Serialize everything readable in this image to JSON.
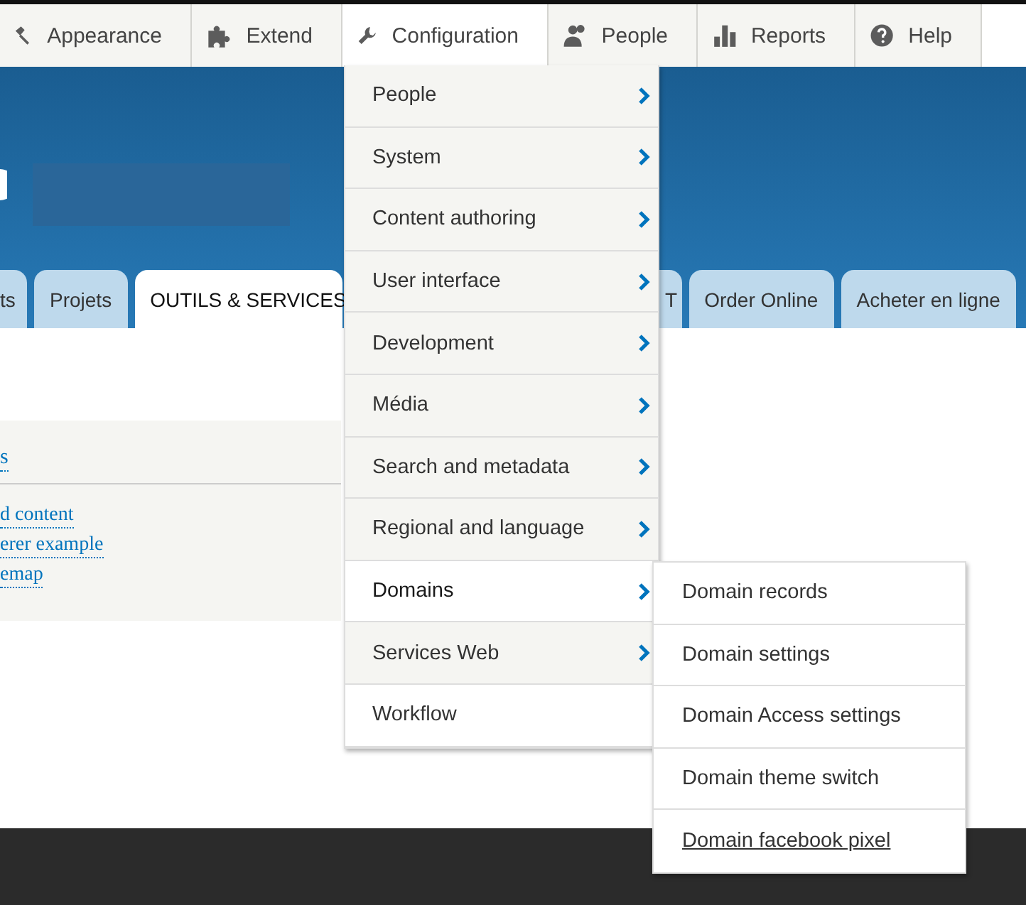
{
  "toolbar": {
    "items": [
      {
        "label": "Appearance",
        "selected": false
      },
      {
        "label": "Extend",
        "selected": false
      },
      {
        "label": "Configuration",
        "selected": true
      },
      {
        "label": "People",
        "selected": false
      },
      {
        "label": "Reports",
        "selected": false
      },
      {
        "label": "Help",
        "selected": false
      }
    ]
  },
  "header": {
    "tabs": [
      {
        "label": "ts",
        "selected": false
      },
      {
        "label": "Projets",
        "selected": false
      },
      {
        "label": "OUTILS & SERVICES",
        "selected": true
      },
      {
        "label": "T",
        "selected": false
      },
      {
        "label": "Order Online",
        "selected": false
      },
      {
        "label": "Acheter en ligne",
        "selected": false
      }
    ]
  },
  "panel": {
    "heading": "s",
    "links": [
      "d content",
      "erer example",
      "emap"
    ]
  },
  "menu": {
    "items": [
      {
        "label": "People",
        "has_submenu": true,
        "expanded": false
      },
      {
        "label": "System",
        "has_submenu": true,
        "expanded": false
      },
      {
        "label": "Content authoring",
        "has_submenu": true,
        "expanded": false
      },
      {
        "label": "User interface",
        "has_submenu": true,
        "expanded": false
      },
      {
        "label": "Development",
        "has_submenu": true,
        "expanded": false
      },
      {
        "label": "Média",
        "has_submenu": true,
        "expanded": false
      },
      {
        "label": "Search and metadata",
        "has_submenu": true,
        "expanded": false
      },
      {
        "label": "Regional and language",
        "has_submenu": true,
        "expanded": false
      },
      {
        "label": "Domains",
        "has_submenu": true,
        "expanded": true
      },
      {
        "label": "Services Web",
        "has_submenu": true,
        "expanded": false
      },
      {
        "label": "Workflow",
        "has_submenu": false,
        "expanded": false
      }
    ]
  },
  "submenu": {
    "items": [
      {
        "label": "Domain records",
        "hovered": false
      },
      {
        "label": "Domain settings",
        "hovered": false
      },
      {
        "label": "Domain Access settings",
        "hovered": false
      },
      {
        "label": "Domain theme switch",
        "hovered": false
      },
      {
        "label": "Domain facebook pixel",
        "hovered": true
      }
    ]
  }
}
